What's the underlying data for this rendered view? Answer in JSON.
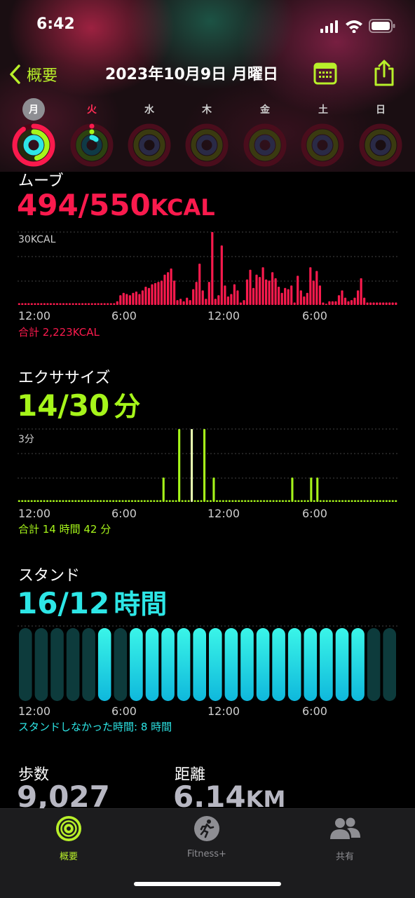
{
  "status_bar": {
    "time": "6:42"
  },
  "nav": {
    "back_label": "概要",
    "title": "2023年10月9日 月曜日"
  },
  "week": [
    {
      "label": "月",
      "selected": true
    },
    {
      "label": "火",
      "today": true
    },
    {
      "label": "水"
    },
    {
      "label": "木"
    },
    {
      "label": "金"
    },
    {
      "label": "土"
    },
    {
      "label": "日"
    }
  ],
  "move": {
    "title": "ムーブ",
    "value": "494/550",
    "unit": "KCAL",
    "scale_label": "30KCAL",
    "total": "合計 2,223KCAL",
    "color": "#fa1a4d",
    "x_ticks": [
      "12:00",
      "6:00",
      "12:00",
      "6:00"
    ]
  },
  "exercise": {
    "title": "エクササイズ",
    "value": "14/30",
    "unit": "分",
    "scale_label": "3分",
    "total": "合計 14 時間 42 分",
    "color": "#a6f51a",
    "x_ticks": [
      "12:00",
      "6:00",
      "12:00",
      "6:00"
    ]
  },
  "stand": {
    "title": "スタンド",
    "value": "16/12",
    "unit": "時間",
    "total": "スタンドしなかった時間: 8 時間",
    "color": "#2de6e6",
    "x_ticks": [
      "12:00",
      "6:00",
      "12:00",
      "6:00"
    ]
  },
  "steps": {
    "label": "歩数",
    "value": "9,027"
  },
  "distance": {
    "label": "距離",
    "value": "6.14",
    "unit": "KM"
  },
  "tabs": [
    {
      "label": "概要",
      "icon": "activity-rings-icon",
      "active": true
    },
    {
      "label": "Fitness+",
      "icon": "runner-icon"
    },
    {
      "label": "共有",
      "icon": "people-icon"
    }
  ],
  "chart_data": [
    {
      "type": "bar",
      "name": "move",
      "ylabel": "30KCAL",
      "x_ticks": [
        "12:00",
        "6:00",
        "12:00",
        "6:00"
      ],
      "ylim": [
        0,
        60
      ],
      "values": [
        0,
        0,
        0,
        0,
        0,
        0,
        0,
        0,
        0,
        0,
        0,
        0,
        0,
        0,
        0,
        0,
        0,
        0,
        0,
        0,
        0,
        0,
        0,
        0,
        0,
        0,
        0,
        0,
        0,
        0,
        0,
        3,
        8,
        10,
        9,
        8,
        10,
        11,
        9,
        12,
        15,
        14,
        17,
        18,
        19,
        20,
        25,
        27,
        30,
        20,
        4,
        5,
        3,
        6,
        4,
        13,
        19,
        34,
        12,
        5,
        19,
        60,
        5,
        8,
        49,
        16,
        7,
        9,
        17,
        12,
        2,
        4,
        21,
        29,
        14,
        25,
        23,
        31,
        21,
        20,
        27,
        22,
        15,
        10,
        14,
        13,
        16,
        2,
        24,
        12,
        7,
        10,
        31,
        20,
        28,
        16,
        2,
        1,
        3,
        3,
        3,
        8,
        12,
        6,
        3,
        4,
        6,
        12,
        22,
        6,
        2,
        2,
        2,
        2,
        2,
        2,
        2,
        2,
        2,
        2
      ]
    },
    {
      "type": "bar",
      "name": "exercise",
      "ylabel": "3分",
      "x_ticks": [
        "12:00",
        "6:00",
        "12:00",
        "6:00"
      ],
      "ylim": [
        0,
        4.5
      ],
      "values": [
        0,
        0,
        0,
        0,
        0,
        0,
        0,
        0,
        0,
        0,
        0,
        0,
        0,
        0,
        0,
        0,
        0,
        0,
        0,
        0,
        0,
        0,
        0,
        0,
        0,
        0,
        0,
        0,
        0,
        0,
        0,
        0,
        0,
        0,
        0,
        0,
        0,
        0,
        0,
        0,
        0,
        0,
        0,
        0,
        0,
        0,
        1.5,
        0,
        0,
        0,
        0,
        4.5,
        0,
        0,
        0,
        4.5,
        0,
        0,
        0,
        4.5,
        0,
        0,
        1.5,
        0,
        0,
        0,
        0,
        0,
        0,
        0,
        0,
        0,
        0,
        0,
        0,
        0,
        0,
        0,
        0,
        0,
        0,
        0,
        0,
        0,
        0,
        0,
        0,
        1.5,
        0,
        0,
        0,
        0,
        0,
        1.5,
        0,
        1.5,
        0,
        0,
        0,
        0,
        0,
        0,
        0,
        0,
        0,
        0,
        0,
        0,
        0,
        0,
        0,
        0,
        0,
        0,
        0,
        0,
        0,
        0,
        0,
        0,
        0
      ]
    },
    {
      "type": "bar",
      "name": "stand",
      "x_ticks": [
        "12:00",
        "6:00",
        "12:00",
        "6:00"
      ],
      "categories": [
        "0",
        "1",
        "2",
        "3",
        "4",
        "5",
        "6",
        "7",
        "8",
        "9",
        "10",
        "11",
        "12",
        "13",
        "14",
        "15",
        "16",
        "17",
        "18",
        "19",
        "20",
        "21",
        "22",
        "23"
      ],
      "values": [
        0,
        0,
        0,
        0,
        0,
        1,
        0,
        1,
        1,
        1,
        1,
        1,
        1,
        1,
        1,
        1,
        1,
        1,
        1,
        1,
        1,
        1,
        0,
        0
      ]
    }
  ]
}
